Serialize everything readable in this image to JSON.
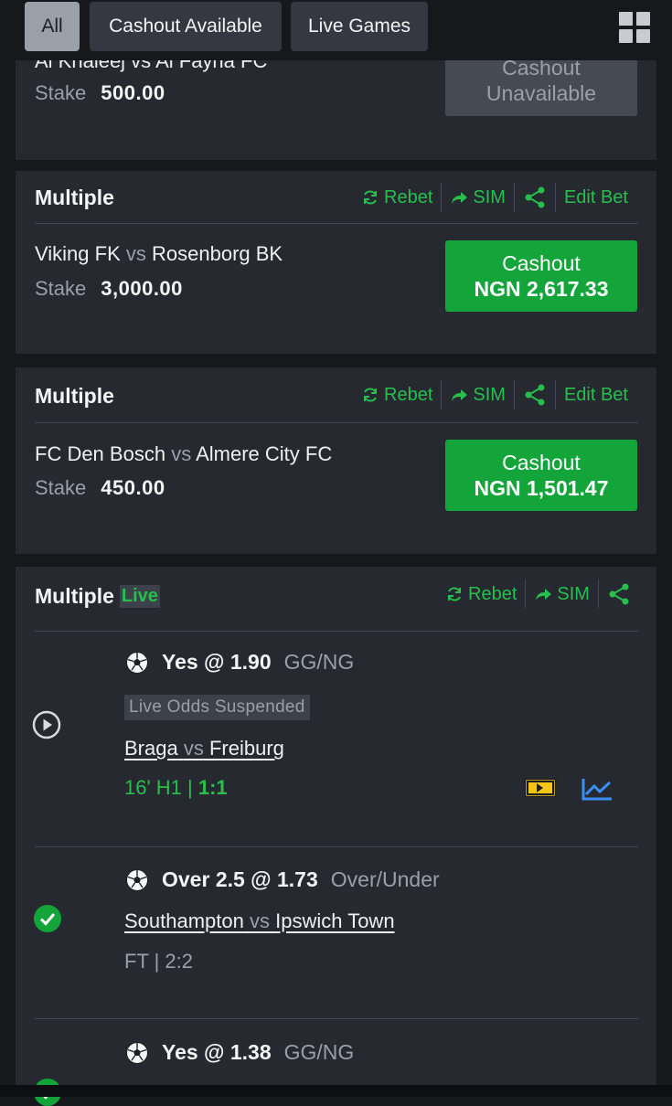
{
  "filters": [
    {
      "label": "All",
      "active": true
    },
    {
      "label": "Cashout Available",
      "active": false
    },
    {
      "label": "Live Games",
      "active": false
    }
  ],
  "actions": {
    "rebet": "Rebet",
    "sim": "SIM",
    "edit": "Edit Bet"
  },
  "stake_label": "Stake",
  "vs": "vs",
  "bets": [
    {
      "match_partial": "Al Khaleej vs Al Fayha FC",
      "stake": "500.00",
      "cashout_line1": "Cashout",
      "cashout_line2": "Unavailable"
    },
    {
      "title": "Multiple",
      "home": "Viking FK",
      "away": "Rosenborg BK",
      "stake": "3,000.00",
      "cashout_line1": "Cashout",
      "cashout_line2": "NGN 2,617.33"
    },
    {
      "title": "Multiple",
      "home": "FC Den Bosch",
      "away": "Almere City FC",
      "stake": "450.00",
      "cashout_line1": "Cashout",
      "cashout_line2": "NGN 1,501.47"
    },
    {
      "title": "Multiple",
      "live_badge": "Live",
      "selections": [
        {
          "pick": "Yes @ 1.90",
          "market": "GG/NG",
          "suspended": "Live Odds Suspended",
          "home": "Braga",
          "away": "Freiburg",
          "status_time": "16' H1 |",
          "status_score": "1:1"
        },
        {
          "pick": "Over 2.5 @ 1.73",
          "market": "Over/Under",
          "home": "Southampton",
          "away": "Ipswich Town",
          "status": "FT | 2:2"
        },
        {
          "pick": "Yes @ 1.38",
          "market": "GG/NG"
        }
      ]
    }
  ],
  "colors": {
    "accent_green": "#27c04c",
    "button_green": "#13a539",
    "card": "#262930",
    "background": "#17181c"
  }
}
